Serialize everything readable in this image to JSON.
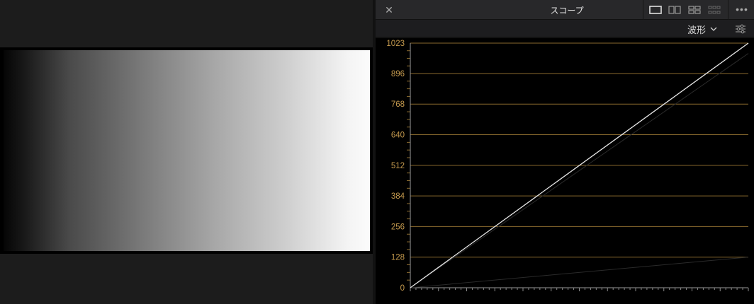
{
  "viewer": {
    "content": "grayscale ramp"
  },
  "scope_panel": {
    "title": "スコープ",
    "close_icon": "close-icon",
    "layout_buttons": [
      "single-layout-icon",
      "dual-layout-icon",
      "quad-layout-icon",
      "multi-layout-icon"
    ],
    "more_icon": "more-horizontal-icon",
    "mode_label": "波形",
    "settings_icon": "sliders-icon"
  },
  "chart_data": {
    "type": "line",
    "scale_labels": [
      "0",
      "128",
      "256",
      "384",
      "512",
      "640",
      "768",
      "896",
      "1023"
    ],
    "ylim": [
      0,
      1023
    ],
    "xlim": [
      0,
      1
    ],
    "grid": true,
    "grid_color": "#8a6a2e",
    "label_color": "#c59a4e",
    "series": [
      {
        "x": [
          0,
          1
        ],
        "values": [
          0,
          1023
        ],
        "color": "#e8e8e8"
      },
      {
        "x": [
          0,
          1
        ],
        "values": [
          0,
          980
        ],
        "color": "#2a2a2a"
      },
      {
        "x": [
          0,
          1
        ],
        "values": [
          0,
          128
        ],
        "color": "#2a2a2a"
      }
    ]
  }
}
